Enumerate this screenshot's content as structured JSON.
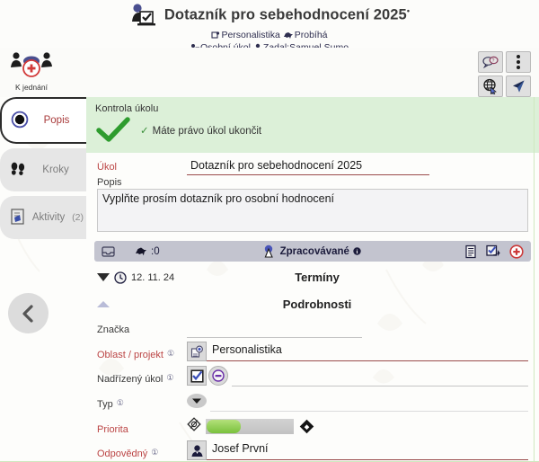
{
  "header": {
    "title": "Dotazník pro sebehodnocení 2025",
    "title_superscript": "•",
    "title_icon": "task-person-icon",
    "sub_project": "Personalistika",
    "sub_project_icon": "project-icon",
    "sub_status": "Probíhá",
    "sub_status_icon": "running-horse-icon",
    "sub_type": "Osobní úkol",
    "sub_type_icon": "personal-task-icon",
    "sub_author": "Zadal:Samuel Sumo",
    "sub_author_icon": "user-icon"
  },
  "topbar": {
    "meeting_button_label": "K jednání",
    "meeting_button_icon": "add-meeting-icon",
    "buttons": [
      {
        "name": "chat-icon",
        "label": "chat-bubbles-icon"
      },
      {
        "name": "kebab-menu-icon",
        "label": "more-vertical-icon"
      },
      {
        "name": "globe-cursor-icon",
        "label": "web-link-icon"
      },
      {
        "name": "flag-icon",
        "label": "dark-flag-icon"
      }
    ]
  },
  "sidebar": {
    "tabs": [
      {
        "label": "Popis",
        "icon": "radio-dot-icon",
        "count": "",
        "active": true
      },
      {
        "label": "Kroky",
        "icon": "footsteps-icon",
        "count": "",
        "active": false
      },
      {
        "label": "Aktivity",
        "icon": "scroll-icon",
        "count": "(2)",
        "active": false
      }
    ],
    "back_button_icon": "chevron-left-icon"
  },
  "alert": {
    "title": "Kontrola úkolu",
    "check_icon": "green-check-icon",
    "message": "Máte právo úkol ukončit",
    "message_tick": "✓",
    "bg_color": "#dcf0d8"
  },
  "form": {
    "ukol_label": "Úkol",
    "ukol_value": "Dotazník pro sebehodnocení 2025",
    "popis_label": "Popis",
    "popis_value": "Vyplňte prosím dotazník pro osobní hodnocení",
    "znacka_label": "Značka",
    "znacka_value": "",
    "oblast_label": "Oblast / projekt",
    "oblast_value": "Personalistika",
    "oblast_icon": "project-picker-icon",
    "nadrizeny_label": "Nadřízený úkol",
    "nadrizeny_value": "",
    "nadrizeny_icon_1": "checkbox-select-icon",
    "nadrizeny_icon_2": "remove-circle-icon",
    "typ_label": "Typ",
    "typ_value": "",
    "typ_icon": "dropdown-caret-icon",
    "priorita_label": "Priorita",
    "priorita_icon": "priority-tag-icon",
    "priorita_marker_icon": "diamond-marker-icon",
    "odpovedny_label": "Odpovědný",
    "odpovedny_value": "Josef První",
    "odpovedny_icon": "person-avatar-icon",
    "info_glyph": "①"
  },
  "statusbar": {
    "inbox_icon": "inbox-icon",
    "horse_icon": "horse-icon",
    "horse_value": ":0",
    "status_icon": "processing-icon",
    "status_text": "Zpracovávané",
    "status_info": "ℹ",
    "right_icons": [
      {
        "name": "document-list-icon"
      },
      {
        "name": "checklist-forward-icon"
      },
      {
        "name": "add-circle-icon"
      }
    ]
  },
  "sections": {
    "terminy_title": "Termíny",
    "terminy_date": "12. 11. 24",
    "terminy_date_icon": "clock-icon",
    "terminy_caret_icon": "caret-down-icon",
    "podrobnosti_title": "Podrobnosti",
    "podrobnosti_caret_icon": "caret-up-icon"
  },
  "colors": {
    "accent_red": "#bb4444",
    "alert_green": "#dcf0d8",
    "check_green": "#3a8f3a",
    "slider_green": "#79c13c",
    "statusbar": "#c3c4cf"
  }
}
